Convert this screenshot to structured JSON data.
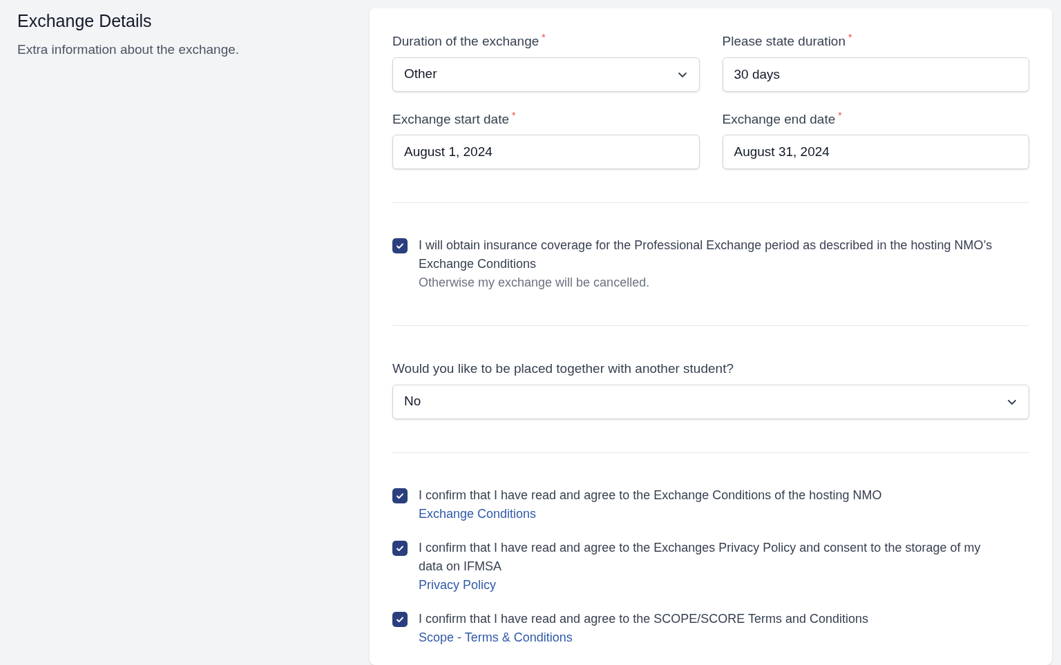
{
  "section": {
    "title": "Exchange Details",
    "description": "Extra information about the exchange."
  },
  "groups": [
    {
      "items": [
        {
          "kind": "field_row",
          "fields": [
            {
              "label": "Duration of the exchange",
              "required_mark": "*",
              "kind": "select",
              "value": "Other"
            },
            {
              "label": "Please state duration",
              "required_mark": "*",
              "kind": "input",
              "value": "30 days"
            }
          ]
        },
        {
          "kind": "field_row",
          "fields": [
            {
              "label": "Exchange start date",
              "required_mark": "*",
              "kind": "input",
              "value": "August 1, 2024"
            },
            {
              "label": "Exchange end date",
              "required_mark": "*",
              "kind": "input",
              "value": "August 31, 2024"
            }
          ]
        }
      ]
    },
    {
      "items": [
        {
          "kind": "checkbox",
          "checked": true,
          "label": "I will obtain insurance coverage for the Professional Exchange period as described in the hosting NMO’s Exchange Conditions",
          "note": "Otherwise my exchange will be cancelled."
        }
      ]
    },
    {
      "items": [
        {
          "kind": "field_row",
          "fields": [
            {
              "label": "Would you like to be placed together with another student?",
              "kind": "select",
              "value": "No"
            }
          ]
        }
      ]
    },
    {
      "items": [
        {
          "kind": "checkbox",
          "checked": true,
          "label": "I confirm that I have read and agree to the Exchange Conditions of the hosting NMO",
          "link": "Exchange Conditions"
        },
        {
          "kind": "checkbox",
          "checked": true,
          "label": "I confirm that I have read and agree to the Exchanges Privacy Policy and consent to the storage of my data on IFMSA",
          "link": "Privacy Policy"
        },
        {
          "kind": "checkbox",
          "checked": true,
          "label": "I confirm that I have read and agree to the SCOPE/SCORE Terms and Conditions",
          "link": "Scope - Terms & Conditions"
        }
      ]
    }
  ]
}
